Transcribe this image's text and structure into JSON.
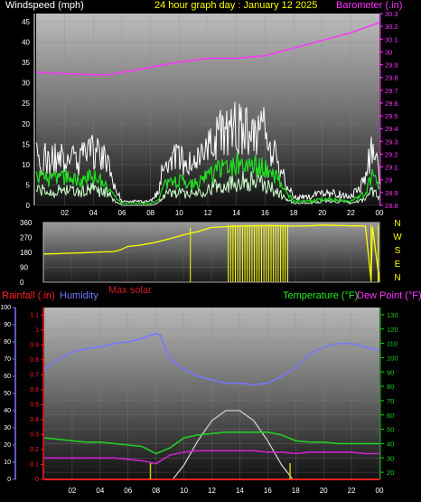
{
  "header": {
    "left_label": "Windspeed (mph)",
    "center_label": "24 hour graph day : January 12 2025",
    "right_label": "Barometer (.in)"
  },
  "wind_panel": {
    "y_ticks": [
      "0",
      "5",
      "10",
      "15",
      "20",
      "25",
      "30",
      "35",
      "40",
      "45"
    ],
    "baro_ticks": [
      "28.8",
      "28.9",
      "29",
      "29.1",
      "29.2",
      "29.3",
      "29.4",
      "29.5",
      "29.6",
      "29.7",
      "29.8",
      "29.9",
      "30",
      "30.1",
      "30.2",
      "30.3"
    ]
  },
  "dir_panel": {
    "y_ticks": [
      "0",
      "90",
      "180",
      "270",
      "360"
    ],
    "compass": [
      "N",
      "W",
      "S",
      "E",
      "N"
    ]
  },
  "bottom_header": {
    "rainfall": "Rainfall (.in)",
    "humidity": "Humidity",
    "max_solar": "Max solar",
    "temperature": "Temperature (°F)",
    "dewpoint": "Dew Point (°F)"
  },
  "bottom_panel": {
    "humidity_ticks": [
      "0",
      "10",
      "20",
      "30",
      "40",
      "50",
      "60",
      "70",
      "80",
      "90",
      "100"
    ],
    "rain_ticks": [
      "0",
      "0.1",
      "0.2",
      "0.3",
      "0.4",
      "0.5",
      "0.6",
      "0.7",
      "0.8",
      "0.9",
      "1",
      "1.1"
    ],
    "temp_ticks": [
      "20",
      "30",
      "40",
      "50",
      "60",
      "70",
      "80",
      "90",
      "100",
      "110",
      "120",
      "130"
    ]
  },
  "x_tick_labels": [
    "02",
    "04",
    "06",
    "08",
    "10",
    "12",
    "14",
    "16",
    "18",
    "20",
    "22",
    "00"
  ],
  "colors": {
    "barometer": "#ff33ff",
    "gust": "#ffffff",
    "wind_avg": "#22dd22",
    "wind_light": "#ccffcc",
    "direction": "#ffff00",
    "humidity": "#7777ff",
    "temperature": "#22cc22",
    "dewpoint": "#cc22cc",
    "solar": "#cccccc",
    "rain": "#ff2222",
    "marker": "#cccc00"
  },
  "chart_data": [
    {
      "type": "line",
      "panel": "wind",
      "x_unit": "hour of day (0-24)",
      "ylim": [
        0,
        47
      ],
      "y2lim": [
        28.8,
        30.3
      ],
      "series": [
        {
          "name": "Barometer (.in)",
          "axis": "right",
          "x": [
            0,
            2,
            4,
            5,
            6,
            8,
            10,
            12,
            14,
            16,
            18,
            20,
            22,
            24
          ],
          "values": [
            29.84,
            29.83,
            29.82,
            29.82,
            29.84,
            29.88,
            29.92,
            29.95,
            29.95,
            29.97,
            30.03,
            30.09,
            30.15,
            30.23
          ]
        },
        {
          "name": "gust",
          "axis": "left",
          "x": [
            0,
            1,
            2,
            3,
            4,
            5,
            5.5,
            6,
            7,
            8,
            8.5,
            9,
            10,
            11,
            12,
            13,
            14,
            15,
            16,
            17,
            17.5,
            18,
            19,
            20,
            21,
            22,
            23,
            23.5,
            24
          ],
          "values": [
            12,
            11,
            12,
            11,
            13,
            11,
            5,
            1,
            1,
            1,
            3,
            11,
            12,
            9,
            14,
            18,
            19,
            19,
            18,
            10,
            5,
            2,
            2,
            3,
            3,
            2,
            6,
            15,
            7
          ]
        },
        {
          "name": "wind average",
          "axis": "left",
          "x": [
            0,
            1,
            2,
            3,
            4,
            5,
            5.5,
            6,
            7,
            8,
            8.5,
            9,
            10,
            11,
            12,
            13,
            14,
            15,
            16,
            17,
            17.5,
            18,
            19,
            20,
            21,
            22,
            23,
            23.5,
            24
          ],
          "values": [
            7,
            6,
            7,
            6,
            7,
            5,
            2,
            0.5,
            0.5,
            0.5,
            1,
            5,
            6,
            5,
            7,
            9,
            10,
            10,
            9,
            6,
            3,
            1,
            1,
            1.5,
            1.5,
            1,
            3,
            8,
            4
          ]
        },
        {
          "name": "wind light",
          "axis": "left",
          "x": [
            0,
            1,
            2,
            3,
            4,
            5,
            5.5,
            6,
            7,
            8,
            8.5,
            9,
            10,
            11,
            12,
            13,
            14,
            15,
            16,
            17,
            17.5,
            18,
            19,
            20,
            21,
            22,
            23,
            23.5,
            24
          ],
          "values": [
            4,
            3,
            4,
            3,
            4,
            3,
            1,
            0,
            0,
            0,
            0.5,
            3,
            3,
            3,
            4,
            5,
            6,
            6,
            5,
            3,
            1.5,
            0.5,
            0.5,
            1,
            1,
            0.5,
            1.5,
            4,
            2
          ]
        }
      ]
    },
    {
      "type": "line",
      "panel": "direction",
      "x_unit": "hour of day (0-24)",
      "ylim": [
        0,
        360
      ],
      "series": [
        {
          "name": "Wind direction",
          "x": [
            0,
            1,
            2,
            3,
            4,
            5,
            5.5,
            6,
            7,
            8,
            9,
            10,
            11,
            12,
            13,
            14,
            15,
            16,
            17,
            18,
            19,
            20,
            21,
            22,
            23,
            23.4,
            23.5,
            24
          ],
          "values": [
            170,
            172,
            175,
            178,
            182,
            185,
            195,
            215,
            225,
            240,
            262,
            285,
            305,
            330,
            335,
            338,
            340,
            342,
            340,
            338,
            340,
            345,
            342,
            340,
            338,
            10,
            335,
            5
          ]
        }
      ]
    },
    {
      "type": "line",
      "panel": "climate",
      "x_unit": "hour of day (0-24)",
      "ylim": [
        0,
        100
      ],
      "y2lim": [
        15,
        135
      ],
      "y3lim": [
        0,
        1.15
      ],
      "series": [
        {
          "name": "Humidity",
          "axis": "left",
          "x": [
            0,
            1,
            2,
            3,
            4,
            5,
            6,
            7,
            8,
            8.3,
            9,
            10,
            11,
            12,
            13,
            14,
            15,
            16,
            17,
            18,
            19,
            20,
            21,
            22,
            23,
            24
          ],
          "values": [
            64,
            70,
            74,
            76,
            77,
            79,
            80,
            82,
            85,
            84,
            70,
            64,
            60,
            58,
            56,
            56,
            55,
            56,
            60,
            65,
            73,
            77,
            79,
            79,
            77,
            75
          ]
        },
        {
          "name": "Temperature (°F)",
          "axis": "right",
          "x": [
            0,
            1,
            2,
            3,
            4,
            5,
            6,
            7,
            8,
            9,
            10,
            11,
            12,
            13,
            14,
            15,
            16,
            17,
            18,
            19,
            20,
            21,
            22,
            23,
            24
          ],
          "values": [
            44,
            43,
            42,
            41,
            41,
            40,
            39,
            38,
            33,
            37,
            44,
            46,
            47,
            48,
            48,
            48,
            48,
            46,
            42,
            41,
            41,
            40,
            40,
            40,
            40
          ]
        },
        {
          "name": "Dew Point (°F)",
          "axis": "right",
          "x": [
            0,
            1,
            2,
            3,
            4,
            5,
            6,
            7,
            8,
            9,
            10,
            11,
            12,
            13,
            14,
            15,
            16,
            17,
            18,
            19,
            20,
            21,
            22,
            23,
            24
          ],
          "values": [
            30,
            30,
            30,
            30,
            30,
            30,
            29,
            28,
            26,
            32,
            34,
            35,
            35,
            35,
            35,
            35,
            34,
            34,
            33,
            34,
            34,
            34,
            34,
            33,
            33
          ]
        },
        {
          "name": "Max solar",
          "axis": "right",
          "x": [
            9.2,
            10,
            11,
            12,
            13,
            14,
            15,
            16,
            17,
            17.8
          ],
          "values": [
            15,
            25,
            42,
            56,
            63,
            63,
            56,
            42,
            25,
            15
          ]
        },
        {
          "name": "Rainfall (.in)",
          "axis": "rain",
          "x": [
            0,
            24
          ],
          "values": [
            0,
            0
          ]
        }
      ]
    }
  ]
}
